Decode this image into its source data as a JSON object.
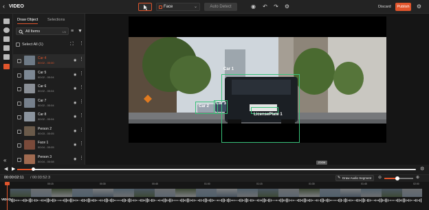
{
  "app": {
    "title": "VIDEO"
  },
  "toolbar": {
    "class_value": "Face",
    "auto_detect_label": "Auto Detect",
    "discard_label": "Discard",
    "publish_label": "Publish"
  },
  "panel": {
    "tabs": [
      "Draw Object",
      "Selections"
    ],
    "search_value": "All Items",
    "search_count": "1/6",
    "select_all_label": "Select All (1)",
    "items": [
      {
        "name": "Car 4",
        "time": "00:02 - 00:00",
        "active": true
      },
      {
        "name": "Car 5",
        "time": "00:02 - 00:04"
      },
      {
        "name": "Car 6",
        "time": "00:02 - 00:04"
      },
      {
        "name": "Car 7",
        "time": "00:02 - 00:04"
      },
      {
        "name": "Car 8",
        "time": "00:02 - 00:04"
      },
      {
        "name": "Person 2",
        "time": "00:03 - 00:05"
      },
      {
        "name": "Face 1",
        "time": "00:04 - 00:05"
      },
      {
        "name": "Person 3",
        "time": "00:04 - 00:08"
      }
    ]
  },
  "video": {
    "labels": [
      "Car 1",
      "Car 2",
      "Car 3",
      "LicensePlate 1"
    ],
    "zoom_badge": "ZOOM"
  },
  "player": {
    "progress": 0.04
  },
  "timeline": {
    "current_time": "00:00:02:11",
    "duration": "/ 00:03:52:3",
    "draw_audio_label": "Draw Audio Segment",
    "zoom_level": 0.45,
    "ticks": [
      "00:15",
      "00:30",
      "00:45",
      "01:00",
      "01:15",
      "01:30",
      "01:45",
      "02:00"
    ],
    "track_label": "VIDEO"
  },
  "colors": {
    "accent": "#e1552c",
    "box": "#39c27a"
  }
}
